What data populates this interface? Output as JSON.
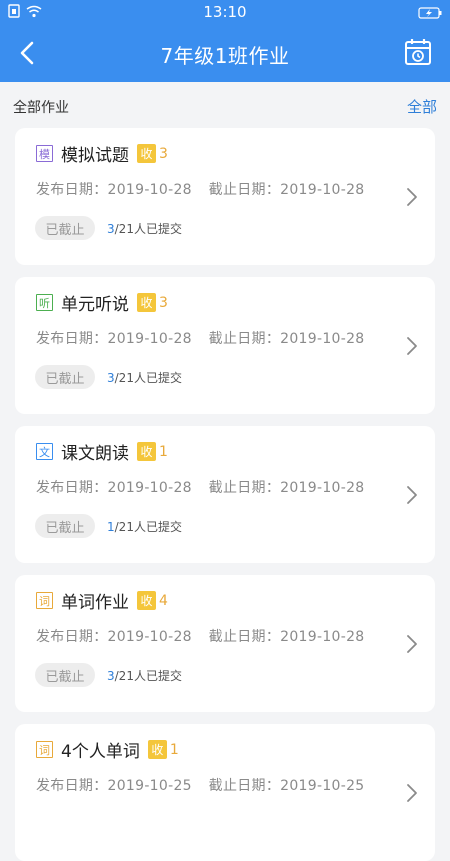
{
  "status_bar": {
    "time": "13:10"
  },
  "nav": {
    "title": "7年级1班作业"
  },
  "section": {
    "label": "全部作业",
    "filter": "全部"
  },
  "homework": [
    {
      "tag": "模",
      "tag_color": "#8a6bd6",
      "name": "模拟试题",
      "recv_label": "收",
      "recv_count": "3",
      "publish_label": "发布日期：",
      "publish_date": "2019-10-28",
      "deadline_label": "截止日期：",
      "deadline_date": "2019-10-28",
      "status": "已截止",
      "submitted": "3",
      "submit_suffix": "/21人已提交"
    },
    {
      "tag": "听",
      "tag_color": "#4caf50",
      "name": "单元听说",
      "recv_label": "收",
      "recv_count": "3",
      "publish_label": "发布日期：",
      "publish_date": "2019-10-28",
      "deadline_label": "截止日期：",
      "deadline_date": "2019-10-28",
      "status": "已截止",
      "submitted": "3",
      "submit_suffix": "/21人已提交"
    },
    {
      "tag": "文",
      "tag_color": "#3a8eef",
      "name": "课文朗读",
      "recv_label": "收",
      "recv_count": "1",
      "publish_label": "发布日期：",
      "publish_date": "2019-10-28",
      "deadline_label": "截止日期：",
      "deadline_date": "2019-10-28",
      "status": "已截止",
      "submitted": "1",
      "submit_suffix": "/21人已提交"
    },
    {
      "tag": "词",
      "tag_color": "#e8a93a",
      "name": "单词作业",
      "recv_label": "收",
      "recv_count": "4",
      "publish_label": "发布日期：",
      "publish_date": "2019-10-28",
      "deadline_label": "截止日期：",
      "deadline_date": "2019-10-28",
      "status": "已截止",
      "submitted": "3",
      "submit_suffix": "/21人已提交"
    },
    {
      "tag": "词",
      "tag_color": "#e8a93a",
      "name": "4个人单词",
      "recv_label": "收",
      "recv_count": "1",
      "publish_label": "发布日期：",
      "publish_date": "2019-10-25",
      "deadline_label": "截止日期：",
      "deadline_date": "2019-10-25",
      "status": "",
      "submitted": "",
      "submit_suffix": ""
    }
  ],
  "colors": {
    "primary": "#3a8eef",
    "accent_yellow": "#f4c63b"
  }
}
